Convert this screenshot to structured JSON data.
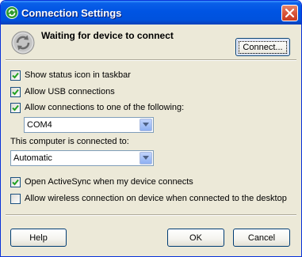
{
  "window": {
    "title": "Connection Settings",
    "icon": "activesync-icon",
    "close_icon": "close-icon"
  },
  "header": {
    "status_icon": "sync-arrows-icon",
    "status_text": "Waiting for device to connect",
    "connect_label": "Connect..."
  },
  "options": {
    "show_status_icon": {
      "label": "Show status icon in taskbar",
      "checked": true
    },
    "allow_usb": {
      "label": "Allow USB connections",
      "checked": true
    },
    "allow_connections": {
      "label": "Allow connections to one of the following:",
      "checked": true
    },
    "port_select": {
      "value": "COM4"
    },
    "connected_to_label": "This computer is connected to:",
    "connected_to_select": {
      "value": "Automatic"
    },
    "open_activesync": {
      "label": "Open ActiveSync when my device connects",
      "checked": true
    },
    "allow_wireless": {
      "label": "Allow wireless connection on device when connected to the desktop",
      "checked": false
    }
  },
  "footer": {
    "help_label": "Help",
    "ok_label": "OK",
    "cancel_label": "Cancel"
  },
  "colors": {
    "titlebar": "#0054e3",
    "dialog_bg": "#ece9d8",
    "close_button": "#d8563b",
    "checkmark": "#21a121"
  }
}
